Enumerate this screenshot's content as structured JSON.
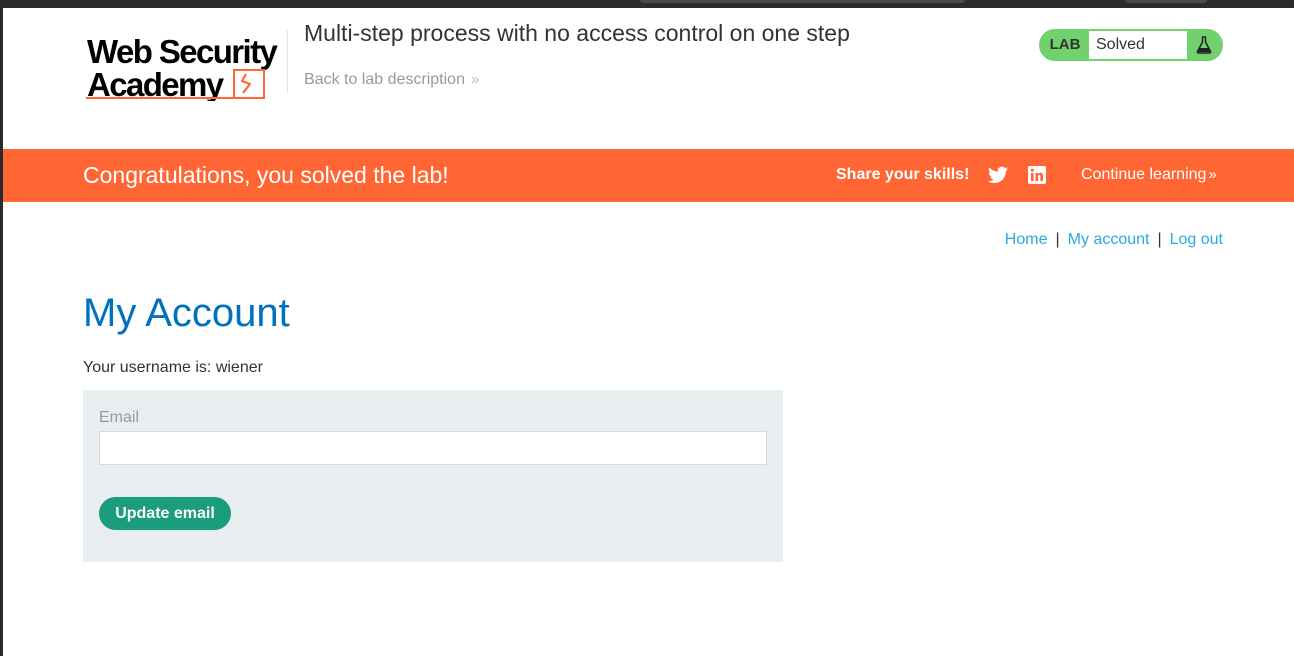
{
  "header": {
    "logo": {
      "line1": "Web Security",
      "line2": "Academy"
    },
    "lab_title": "Multi-step process with no access control on one step",
    "back_link": "Back to lab description",
    "lab_status": {
      "label": "LAB",
      "state": "Solved",
      "color": "#70d16d"
    }
  },
  "banner": {
    "message": "Congratulations, you solved the lab!",
    "share_label": "Share your skills!",
    "continue_link": "Continue learning",
    "color": "#ff6633"
  },
  "nav": {
    "home": "Home",
    "my_account": "My account",
    "log_out": "Log out",
    "separator": "|"
  },
  "main": {
    "title": "My Account",
    "username_line": "Your username is: wiener",
    "form": {
      "email_label": "Email",
      "email_value": "",
      "submit_label": "Update email"
    }
  },
  "colors": {
    "accent_blue": "#0071bc",
    "link_blue": "#29abe0",
    "button_green": "#1a9c7f",
    "form_bg": "#e8eef0"
  }
}
